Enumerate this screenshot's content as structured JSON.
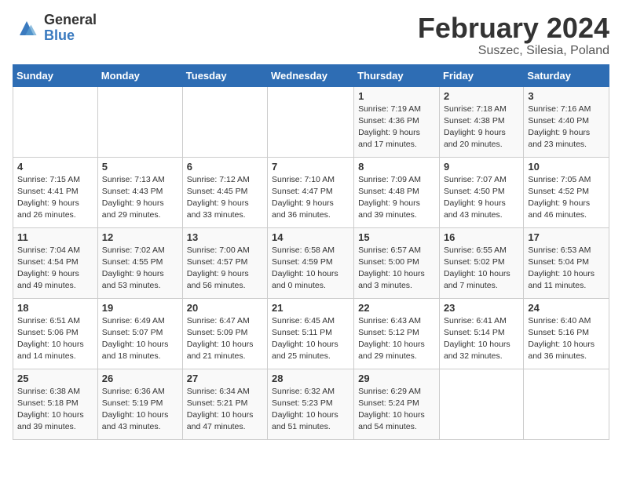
{
  "logo": {
    "general": "General",
    "blue": "Blue"
  },
  "header": {
    "month": "February 2024",
    "location": "Suszec, Silesia, Poland"
  },
  "days_of_week": [
    "Sunday",
    "Monday",
    "Tuesday",
    "Wednesday",
    "Thursday",
    "Friday",
    "Saturday"
  ],
  "weeks": [
    [
      {
        "day": "",
        "detail": ""
      },
      {
        "day": "",
        "detail": ""
      },
      {
        "day": "",
        "detail": ""
      },
      {
        "day": "",
        "detail": ""
      },
      {
        "day": "1",
        "detail": "Sunrise: 7:19 AM\nSunset: 4:36 PM\nDaylight: 9 hours\nand 17 minutes."
      },
      {
        "day": "2",
        "detail": "Sunrise: 7:18 AM\nSunset: 4:38 PM\nDaylight: 9 hours\nand 20 minutes."
      },
      {
        "day": "3",
        "detail": "Sunrise: 7:16 AM\nSunset: 4:40 PM\nDaylight: 9 hours\nand 23 minutes."
      }
    ],
    [
      {
        "day": "4",
        "detail": "Sunrise: 7:15 AM\nSunset: 4:41 PM\nDaylight: 9 hours\nand 26 minutes."
      },
      {
        "day": "5",
        "detail": "Sunrise: 7:13 AM\nSunset: 4:43 PM\nDaylight: 9 hours\nand 29 minutes."
      },
      {
        "day": "6",
        "detail": "Sunrise: 7:12 AM\nSunset: 4:45 PM\nDaylight: 9 hours\nand 33 minutes."
      },
      {
        "day": "7",
        "detail": "Sunrise: 7:10 AM\nSunset: 4:47 PM\nDaylight: 9 hours\nand 36 minutes."
      },
      {
        "day": "8",
        "detail": "Sunrise: 7:09 AM\nSunset: 4:48 PM\nDaylight: 9 hours\nand 39 minutes."
      },
      {
        "day": "9",
        "detail": "Sunrise: 7:07 AM\nSunset: 4:50 PM\nDaylight: 9 hours\nand 43 minutes."
      },
      {
        "day": "10",
        "detail": "Sunrise: 7:05 AM\nSunset: 4:52 PM\nDaylight: 9 hours\nand 46 minutes."
      }
    ],
    [
      {
        "day": "11",
        "detail": "Sunrise: 7:04 AM\nSunset: 4:54 PM\nDaylight: 9 hours\nand 49 minutes."
      },
      {
        "day": "12",
        "detail": "Sunrise: 7:02 AM\nSunset: 4:55 PM\nDaylight: 9 hours\nand 53 minutes."
      },
      {
        "day": "13",
        "detail": "Sunrise: 7:00 AM\nSunset: 4:57 PM\nDaylight: 9 hours\nand 56 minutes."
      },
      {
        "day": "14",
        "detail": "Sunrise: 6:58 AM\nSunset: 4:59 PM\nDaylight: 10 hours\nand 0 minutes."
      },
      {
        "day": "15",
        "detail": "Sunrise: 6:57 AM\nSunset: 5:00 PM\nDaylight: 10 hours\nand 3 minutes."
      },
      {
        "day": "16",
        "detail": "Sunrise: 6:55 AM\nSunset: 5:02 PM\nDaylight: 10 hours\nand 7 minutes."
      },
      {
        "day": "17",
        "detail": "Sunrise: 6:53 AM\nSunset: 5:04 PM\nDaylight: 10 hours\nand 11 minutes."
      }
    ],
    [
      {
        "day": "18",
        "detail": "Sunrise: 6:51 AM\nSunset: 5:06 PM\nDaylight: 10 hours\nand 14 minutes."
      },
      {
        "day": "19",
        "detail": "Sunrise: 6:49 AM\nSunset: 5:07 PM\nDaylight: 10 hours\nand 18 minutes."
      },
      {
        "day": "20",
        "detail": "Sunrise: 6:47 AM\nSunset: 5:09 PM\nDaylight: 10 hours\nand 21 minutes."
      },
      {
        "day": "21",
        "detail": "Sunrise: 6:45 AM\nSunset: 5:11 PM\nDaylight: 10 hours\nand 25 minutes."
      },
      {
        "day": "22",
        "detail": "Sunrise: 6:43 AM\nSunset: 5:12 PM\nDaylight: 10 hours\nand 29 minutes."
      },
      {
        "day": "23",
        "detail": "Sunrise: 6:41 AM\nSunset: 5:14 PM\nDaylight: 10 hours\nand 32 minutes."
      },
      {
        "day": "24",
        "detail": "Sunrise: 6:40 AM\nSunset: 5:16 PM\nDaylight: 10 hours\nand 36 minutes."
      }
    ],
    [
      {
        "day": "25",
        "detail": "Sunrise: 6:38 AM\nSunset: 5:18 PM\nDaylight: 10 hours\nand 39 minutes."
      },
      {
        "day": "26",
        "detail": "Sunrise: 6:36 AM\nSunset: 5:19 PM\nDaylight: 10 hours\nand 43 minutes."
      },
      {
        "day": "27",
        "detail": "Sunrise: 6:34 AM\nSunset: 5:21 PM\nDaylight: 10 hours\nand 47 minutes."
      },
      {
        "day": "28",
        "detail": "Sunrise: 6:32 AM\nSunset: 5:23 PM\nDaylight: 10 hours\nand 51 minutes."
      },
      {
        "day": "29",
        "detail": "Sunrise: 6:29 AM\nSunset: 5:24 PM\nDaylight: 10 hours\nand 54 minutes."
      },
      {
        "day": "",
        "detail": ""
      },
      {
        "day": "",
        "detail": ""
      }
    ]
  ]
}
